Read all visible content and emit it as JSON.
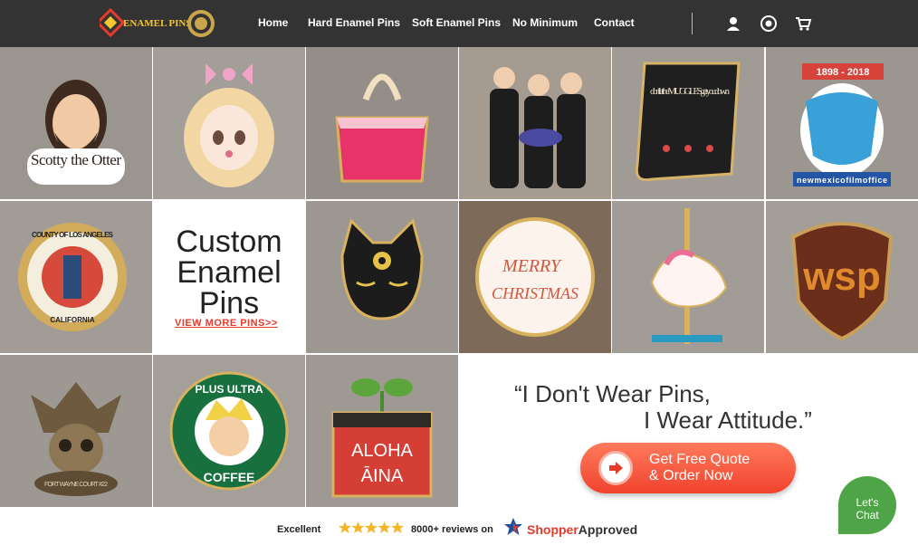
{
  "nav": {
    "logo_text": "ENAMEL PINS",
    "items": [
      "Home",
      "Hard Enamel Pins",
      "Soft Enamel Pins",
      "No Minimum",
      "Contact"
    ],
    "icons": [
      "user-icon",
      "gift-icon",
      "cart-icon"
    ]
  },
  "gallery": {
    "pins": [
      {
        "name": "scotty-otter",
        "text": "Scotty the Otter"
      },
      {
        "name": "anime-girl",
        "text": ""
      },
      {
        "name": "pink-handbag",
        "text": ""
      },
      {
        "name": "team-photo",
        "text": ""
      },
      {
        "name": "muggles",
        "text": "don't let the MUGGLES get you down"
      },
      {
        "name": "new-mexico",
        "text": "1898 - 2018",
        "text2": "newmexicofilmoffice"
      },
      {
        "name": "county-la",
        "text": "COUNTY OF LOS ANGELES",
        "text2": "CALIFORNIA"
      },
      {
        "name": "black-cat",
        "text": ""
      },
      {
        "name": "merry-christmas",
        "text": "MERRY",
        "text2": "CHRISTMAS"
      },
      {
        "name": "carousel-horse",
        "text": ""
      },
      {
        "name": "wsp-shield",
        "text": "wsp"
      },
      {
        "name": "jester-skull",
        "text": "FORT WAYNE COURT #22"
      },
      {
        "name": "plus-ultra",
        "text": "PLUS ULTRA",
        "text2": "COFFEE"
      },
      {
        "name": "aloha-aina",
        "text": "ALOHA",
        "text2": "ĀINA"
      }
    ]
  },
  "hero": {
    "title_line1": "Custom",
    "title_line2": "Enamel",
    "title_line3": "Pins",
    "link": "VIEW MORE PINS>>"
  },
  "quote": {
    "line1": "“I Don't Wear Pins,",
    "line2": "I Wear Attitude.”"
  },
  "cta": {
    "line1": "Get Free Quote",
    "line2": "& Order Now"
  },
  "footer": {
    "rating_word": "Excellent",
    "stars": 5,
    "reviews": "8000+ reviews on",
    "brand_prefix": "Shopper",
    "brand_suffix": "Approved"
  },
  "chat": {
    "line1": "Let's",
    "line2": "Chat"
  },
  "colors": {
    "nav_bg": "#333333",
    "accent": "#e53a2c",
    "chat": "#4fa447"
  }
}
